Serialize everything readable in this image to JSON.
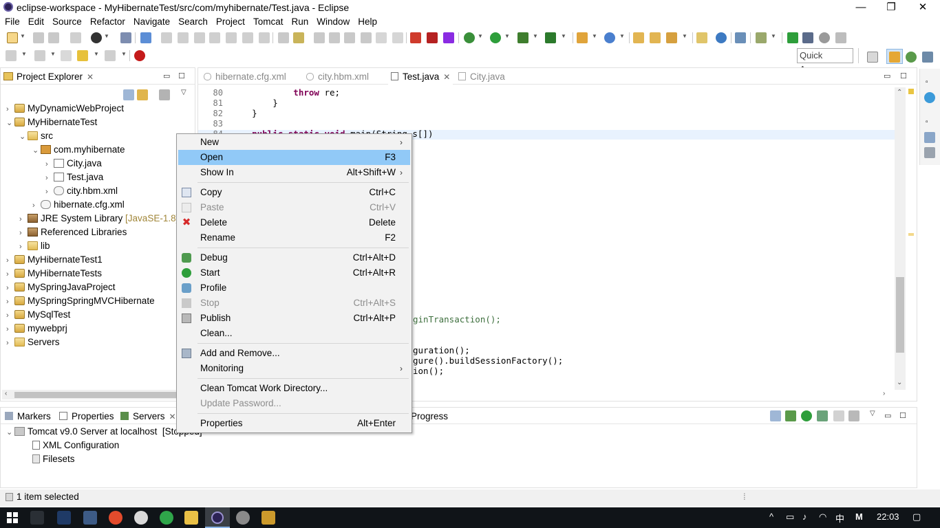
{
  "window": {
    "title": "eclipse-workspace - MyHibernateTest/src/com/myhibernate/Test.java - Eclipse",
    "controls": {
      "minimize": "—",
      "maximize": "❐",
      "close": "✕"
    }
  },
  "menubar": [
    "File",
    "Edit",
    "Source",
    "Refactor",
    "Navigate",
    "Search",
    "Project",
    "Tomcat",
    "Run",
    "Window",
    "Help"
  ],
  "toolbar": {
    "quick_access": "Quick Access"
  },
  "project_explorer": {
    "tab_label": "Project Explorer",
    "tree": [
      {
        "label": "MyDynamicWebProject"
      },
      {
        "label": "MyHibernateTest"
      },
      {
        "label": "src"
      },
      {
        "label": "com.myhibernate"
      },
      {
        "label": "City.java"
      },
      {
        "label": "Test.java"
      },
      {
        "label": "city.hbm.xml"
      },
      {
        "label": "hibernate.cfg.xml"
      },
      {
        "label": "JRE System Library",
        "decoration": "[JavaSE-1.8]"
      },
      {
        "label": "Referenced Libraries"
      },
      {
        "label": "lib"
      },
      {
        "label": "MyHibernateTest1"
      },
      {
        "label": "MyHibernateTests"
      },
      {
        "label": "MySpringJavaProject"
      },
      {
        "label": "MySpringSpringMVCHibernate"
      },
      {
        "label": "MySqlTest"
      },
      {
        "label": "mywebprj"
      },
      {
        "label": "Servers"
      }
    ]
  },
  "editor": {
    "tabs": [
      "hibernate.cfg.xml",
      "city.hbm.xml",
      "Test.java",
      "City.java"
    ],
    "active_tab": "Test.java",
    "lines": [
      {
        "num": "80",
        "text": "            throw re;"
      },
      {
        "num": "81",
        "text": "        }"
      },
      {
        "num": "82",
        "text": "    }"
      },
      {
        "num": "83",
        "text": ""
      },
      {
        "num": "84",
        "text": "    public static void main(String s[])"
      }
    ],
    "fragments": [
      "ginTransaction();",
      "guration();",
      "gure().buildSessionFactory();",
      "ion();"
    ]
  },
  "context_menu": {
    "items": [
      {
        "label": "New",
        "accel": "",
        "submenu": true
      },
      {
        "label": "Open",
        "accel": "F3",
        "highlighted": true
      },
      {
        "label": "Show In",
        "accel": "Alt+Shift+W",
        "submenu": true
      },
      {
        "label": "Copy",
        "accel": "Ctrl+C",
        "icon": "copy-icon"
      },
      {
        "label": "Paste",
        "accel": "Ctrl+V",
        "disabled": true,
        "icon": "paste-icon"
      },
      {
        "label": "Delete",
        "accel": "Delete",
        "icon": "delete-icon"
      },
      {
        "label": "Rename",
        "accel": "F2"
      },
      {
        "label": "Debug",
        "accel": "Ctrl+Alt+D",
        "icon": "debug-icon"
      },
      {
        "label": "Start",
        "accel": "Ctrl+Alt+R",
        "icon": "start-icon"
      },
      {
        "label": "Profile",
        "accel": "",
        "icon": "profile-icon"
      },
      {
        "label": "Stop",
        "accel": "Ctrl+Alt+S",
        "disabled": true,
        "icon": "stop-icon"
      },
      {
        "label": "Publish",
        "accel": "Ctrl+Alt+P",
        "icon": "publish-icon"
      },
      {
        "label": "Clean...",
        "accel": ""
      },
      {
        "label": "Add and Remove...",
        "accel": "",
        "icon": "add-remove-icon"
      },
      {
        "label": "Monitoring",
        "accel": "",
        "submenu": true
      },
      {
        "label": "Clean Tomcat Work Directory...",
        "accel": ""
      },
      {
        "label": "Update Password...",
        "accel": "",
        "disabled": true
      },
      {
        "label": "Properties",
        "accel": "Alt+Enter"
      }
    ]
  },
  "bottom_panel": {
    "tabs": [
      "Markers",
      "Properties",
      "Servers"
    ],
    "hidden_tab_fragment": "Progress",
    "server": {
      "name": "Tomcat v9.0 Server at localhost",
      "state": "[Stopped]"
    },
    "children": [
      "XML Configuration",
      "Filesets"
    ]
  },
  "statusbar": {
    "text": "1 item selected"
  },
  "taskbar": {
    "clock": "22:03",
    "ime": "M"
  },
  "colors": {
    "menu_highlight": "#91c9f7",
    "keyword": "#7f0055",
    "taskbar": "#101418"
  }
}
